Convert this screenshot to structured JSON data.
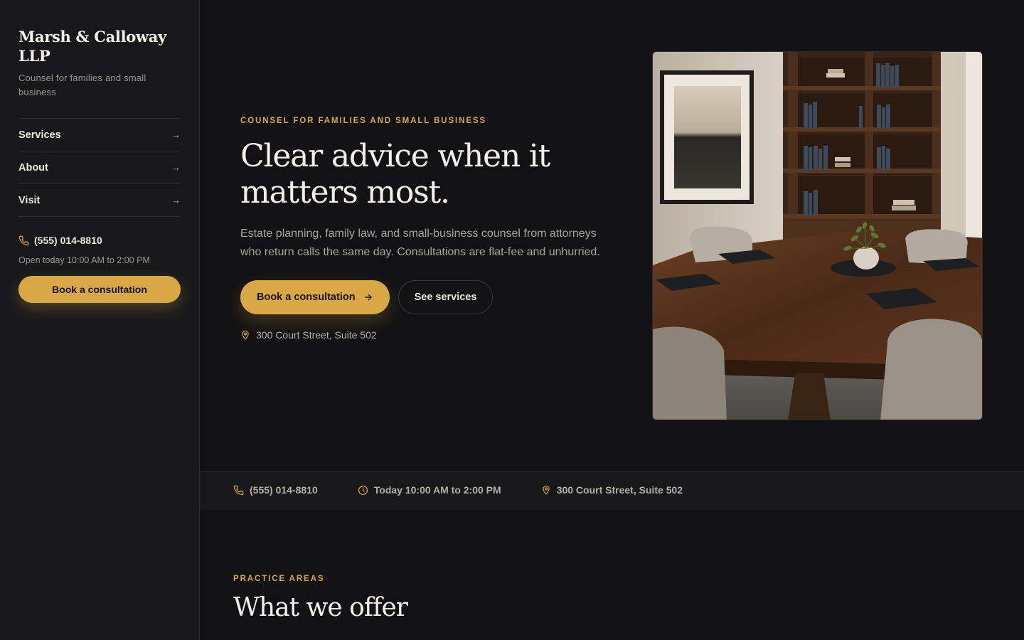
{
  "brand": {
    "name": "Marsh & Calloway LLP",
    "tagline": "Counsel for families and small business"
  },
  "sidebar": {
    "nav": [
      {
        "label": "Services",
        "icon": "arrow-right-icon"
      },
      {
        "label": "About",
        "icon": "arrow-right-icon"
      },
      {
        "label": "Visit",
        "icon": "arrow-right-icon"
      }
    ],
    "phone": "(555) 014-8810",
    "hours": "Open today 10:00 AM to 2:00 PM",
    "cta_label": "Book a consultation"
  },
  "hero": {
    "eyebrow": "COUNSEL FOR FAMILIES AND SMALL BUSINESS",
    "title": "Clear advice when it matters most.",
    "lead": "Estate planning, family law, and small-business counsel from attorneys who return calls the same day. Consultations are flat-fee and unhurried.",
    "primary_label": "Book a consultation",
    "secondary_label": "See services",
    "address": "300 Court Street, Suite 502"
  },
  "infobar": {
    "phone": "(555) 014-8810",
    "hours": "Today 10:00 AM to 2:00 PM",
    "address": "300 Court Street, Suite 502"
  },
  "section": {
    "eyebrow": "PRACTICE AREAS",
    "title": "What we offer"
  },
  "colors": {
    "accent": "#D9A846",
    "background": "#121214",
    "sidebar": "#18181b",
    "text": "#ECE9E3",
    "muted": "#a9a69e"
  }
}
